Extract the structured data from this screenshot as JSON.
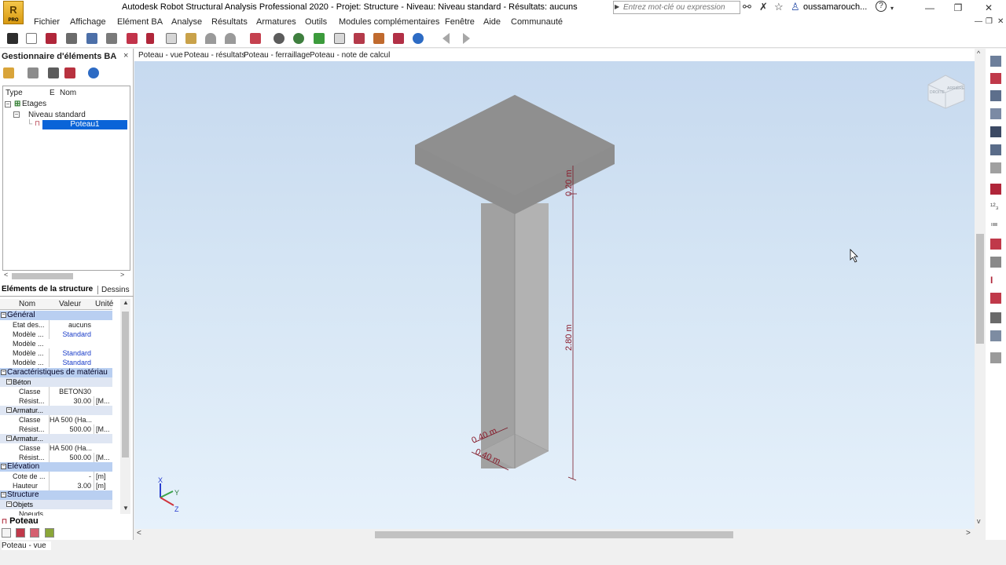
{
  "app": {
    "logo_text": "R",
    "logo_sub": "PRO",
    "title": "Autodesk Robot Structural Analysis Professional 2020 - Projet: Structure - Niveau: Niveau standard - Résultats: aucuns",
    "search_placeholder": "Entrez mot-clé ou expression",
    "user": "oussamarouch...",
    "help_icon": "?",
    "window_controls": [
      "—",
      "❐",
      "✕"
    ]
  },
  "menu": {
    "items": [
      "Fichier",
      "Affichage",
      "Elément BA",
      "Analyse",
      "Résultats",
      "Armatures",
      "Outils",
      "Modules complémentaires",
      "Fenêtre",
      "Aide",
      "Communauté"
    ],
    "mdi_controls": [
      "—",
      "❐",
      "✕"
    ]
  },
  "left_panel": {
    "title": "Gestionnaire d'éléments BA",
    "close": "×",
    "tree_headers": [
      "Type",
      "E",
      "Nom"
    ],
    "tree": {
      "root": "Etages",
      "level": "Niveau standard",
      "element": "Poteau1"
    },
    "tabs": [
      "Eléments de la structure",
      "Dessins"
    ],
    "prop_headers": [
      "Nom",
      "Valeur",
      "Unité"
    ],
    "sections": {
      "general": "Général",
      "materials": "Caractéristiques de matériau",
      "beton": "Béton",
      "armatur1": "Armatur...",
      "armatur2": "Armatur...",
      "elevation": "Elévation",
      "structure": "Structure",
      "objets": "Objets"
    },
    "rows": {
      "etat": {
        "name": "Etat des...",
        "value": "aucuns",
        "unit": ""
      },
      "modele1": {
        "name": "Modèle ...",
        "value": "Standard",
        "unit": ""
      },
      "modele2": {
        "name": "Modèle ...",
        "value": "",
        "unit": ""
      },
      "modele3": {
        "name": "Modèle ...",
        "value": "Standard",
        "unit": ""
      },
      "modele4": {
        "name": "Modèle ...",
        "value": "Standard",
        "unit": ""
      },
      "beton_classe": {
        "name": "Classe",
        "value": "BETON30",
        "unit": ""
      },
      "beton_resist": {
        "name": "Résist...",
        "value": "30.00",
        "unit": "[M..."
      },
      "arm1_classe": {
        "name": "Classe",
        "value": "HA 500 (Ha...",
        "unit": ""
      },
      "arm1_resist": {
        "name": "Résist...",
        "value": "500.00",
        "unit": "[M..."
      },
      "arm2_classe": {
        "name": "Classe",
        "value": "HA 500 (Ha...",
        "unit": ""
      },
      "arm2_resist": {
        "name": "Résist...",
        "value": "500.00",
        "unit": "[M..."
      },
      "cote": {
        "name": "Cote de ...",
        "value": "-",
        "unit": "[m]"
      },
      "hauteur": {
        "name": "Hauteur",
        "value": "3.00",
        "unit": "[m]"
      },
      "noeuds": {
        "name": "Noeuds",
        "value": "",
        "unit": ""
      }
    },
    "bottom_tab": "Poteau"
  },
  "view": {
    "tabs": [
      "Poteau - vue",
      "Poteau - résultats",
      "Poteau - ferraillage",
      "Poteau - note de calcul"
    ],
    "active_tab": "Poteau - vue",
    "dim_slab": "0.20 m",
    "dim_height": "2.80 m",
    "dim_width": "0.40 m",
    "dim_depth": "0.40 m",
    "axes": {
      "x": "X",
      "y": "Y",
      "z": "Z"
    },
    "viewcube_labels": [
      "DROITE",
      "ARRIÈRE"
    ],
    "colors": {
      "concrete_top": "#8d8d8d",
      "concrete_front": "#a2a2a2",
      "concrete_side": "#b0b0b0",
      "dimension": "#8b1c2c"
    }
  },
  "status": {
    "text": "Poteau - vue"
  }
}
